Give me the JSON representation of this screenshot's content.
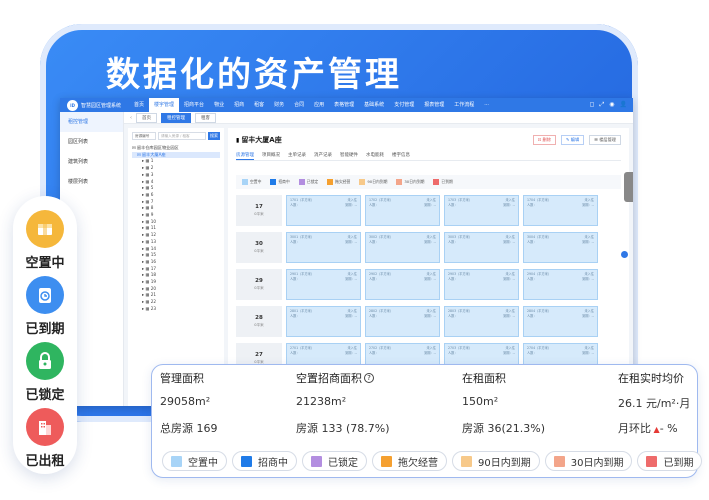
{
  "headline": "数据化的资产管理",
  "app": {
    "title": "智慧园区管理系统",
    "logo_text": "ID",
    "nav": [
      "首页",
      "楼宇管理",
      "招商平台",
      "物业",
      "招商",
      "租客",
      "财务",
      "合同",
      "应用",
      "表格管理",
      "基础系统",
      "支付管理",
      "报表管理",
      "工作流程",
      "···"
    ],
    "nav_active_index": 1,
    "top_icons": [
      "◻",
      "⤢",
      "◉",
      "👤"
    ],
    "sidebar": [
      "租控管理",
      "园区列表",
      "建筑列表",
      "楼层列表"
    ],
    "sidebar_active_index": 0,
    "tabs": [
      "首页",
      "租控管理",
      "租客"
    ],
    "tabs_active_index": 1,
    "tree_search": {
      "select": "房源编号",
      "placeholder": "请输入房源 / 租客",
      "button": "搜索"
    },
    "tree_root": "⊟ 留丰仓库园区物业园区",
    "tree_building": "⊟ 留丰大厦A座",
    "tree_floors": [
      "1",
      "2",
      "3",
      "4",
      "5",
      "6",
      "7",
      "8",
      "9",
      "10",
      "11",
      "12",
      "13",
      "14",
      "15",
      "16",
      "17",
      "18",
      "19",
      "20",
      "21",
      "22",
      "23"
    ],
    "panel": {
      "title": "留丰大厦A座",
      "buttons": {
        "delete": "删除",
        "edit": "编辑",
        "template": "楼层管理"
      },
      "subtabs": [
        "房源管理",
        "项目概况",
        "主单记录",
        "消产记录",
        "智能硬件",
        "水电能耗",
        "楼宇信息"
      ],
      "subtab_active_index": 0,
      "mini_legend": [
        {
          "label": "空置中",
          "color": "#a8d4f7"
        },
        {
          "label": "招商中",
          "color": "#1f7be8"
        },
        {
          "label": "已锁定",
          "color": "#b38ee0"
        },
        {
          "label": "拖欠经营",
          "color": "#f5a030"
        },
        {
          "label": "90日内到期",
          "color": "#f7c98a"
        },
        {
          "label": "30日内到期",
          "color": "#f3a58a"
        },
        {
          "label": "已到期",
          "color": "#ee6b6b"
        }
      ],
      "floors": [
        {
          "num": "17",
          "area": "0平米",
          "units": [
            "1701（平方米）",
            "1702（平方米）",
            "1703（平方米）",
            "1704（平方米）"
          ]
        },
        {
          "num": "30",
          "area": "0平米",
          "units": [
            "3001（平方米）",
            "3002（平方米）",
            "3003（平方米）",
            "3004（平方米）"
          ]
        },
        {
          "num": "29",
          "area": "0平米",
          "units": [
            "2901（平方米）",
            "2902（平方米）",
            "2903（平方米）",
            "2904（平方米）"
          ]
        },
        {
          "num": "28",
          "area": "0平米",
          "units": [
            "2801（平方米）",
            "2802（平方米）",
            "2803（平方米）",
            "2804（平方米）"
          ]
        },
        {
          "num": "27",
          "area": "0平米",
          "units": [
            "2701（平方米）",
            "2702（平方米）",
            "2703（平方米）",
            "2704（平方米）"
          ]
        }
      ],
      "unit_status": "未入住",
      "unit_people": "人数：",
      "unit_expire": "到期：--"
    }
  },
  "status_pill": [
    {
      "label": "空置中",
      "icon": "box-icon",
      "color": "#f5b73b"
    },
    {
      "label": "已到期",
      "icon": "clipboard-clock-icon",
      "color": "#3d8ef0"
    },
    {
      "label": "已锁定",
      "icon": "lock-icon",
      "color": "#2fb560"
    },
    {
      "label": "已出租",
      "icon": "building-icon",
      "color": "#ee5b5b"
    }
  ],
  "stats": {
    "columns": [
      {
        "head": "管理面积",
        "value": "29058m²",
        "sub": "总房源 169"
      },
      {
        "head": "空置招商面积",
        "value": "21238m²",
        "sub": "房源 133 (78.7%)"
      },
      {
        "head": "在租面积",
        "value": "150m²",
        "sub": "房源 36(21.3%)"
      },
      {
        "head": "在租实时均价",
        "value": "26.1 元/m²·月",
        "sub": "月环比",
        "sub_suffix": "- %"
      }
    ],
    "legend": [
      {
        "label": "空置中",
        "color": "#a8d4f7"
      },
      {
        "label": "招商中",
        "color": "#1f7be8"
      },
      {
        "label": "已锁定",
        "color": "#b38ee0"
      },
      {
        "label": "拖欠经营",
        "color": "#f5a030"
      },
      {
        "label": "90日内到期",
        "color": "#f7c98a"
      },
      {
        "label": "30日内到期",
        "color": "#f3a58a"
      },
      {
        "label": "已到期",
        "color": "#ee6b6b"
      }
    ]
  }
}
